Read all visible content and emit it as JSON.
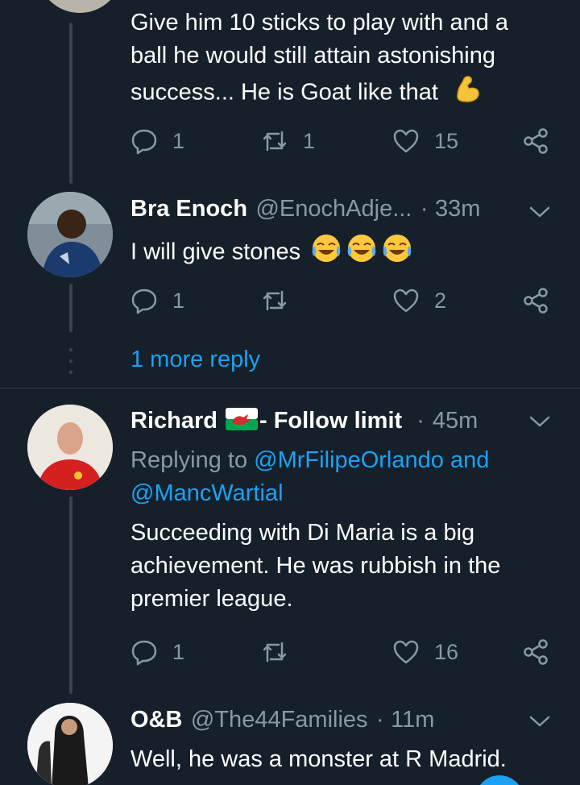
{
  "colors": {
    "background": "#15202b",
    "text": "#ffffff",
    "muted": "#8899a6",
    "link": "#1da1f2",
    "divider": "#38444d"
  },
  "tweet1": {
    "text_line1": "Give him 10 sticks to play with and a",
    "text_line2": "ball he would still attain astonishing",
    "text_line3": "success... He is Goat like that",
    "emoji": "flexed-biceps",
    "replies": "1",
    "retweets": "1",
    "likes": "15"
  },
  "tweet2": {
    "name": "Bra Enoch",
    "handle": "@EnochAdje...",
    "sep": "·",
    "time": "33m",
    "text": "I will give stones",
    "emoji": "face-with-tears-of-joy x3",
    "replies": "1",
    "likes": "2"
  },
  "more_replies": "1 more reply",
  "tweet3": {
    "name": "Richard",
    "flag": "wales-flag",
    "name_suffix": "- Follow limit",
    "sep": "·",
    "time": "45m",
    "replying_prefix": "Replying to",
    "replying_to1": "@MrFilipeOrlando",
    "replying_and": "and",
    "replying_to2": "@MancWartial",
    "text_line1": "Succeeding with Di Maria is a big",
    "text_line2": "achievement. He was rubbish in the",
    "text_line3": "premier league.",
    "replies": "1",
    "likes": "16"
  },
  "tweet4": {
    "name": "O&B",
    "handle": "@The44Families",
    "sep": "·",
    "time": "11m",
    "text": "Well, he was a monster at R Madrid."
  }
}
